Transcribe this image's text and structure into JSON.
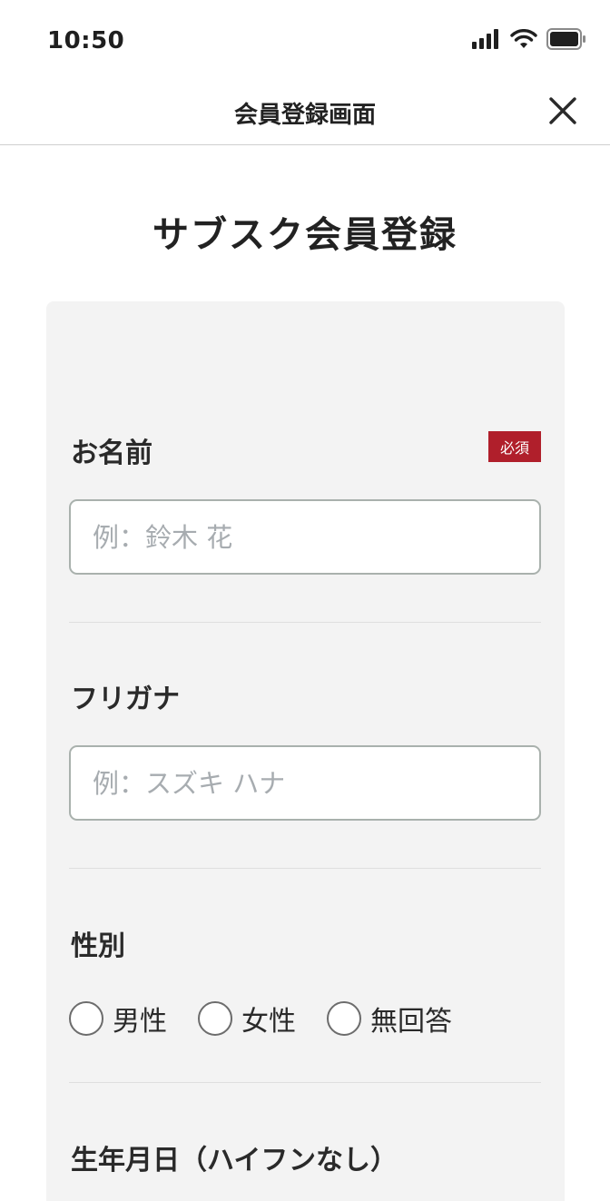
{
  "status_bar": {
    "time": "10:50"
  },
  "nav": {
    "title": "会員登録画面"
  },
  "page": {
    "heading": "サブスク会員登録"
  },
  "form": {
    "name": {
      "label": "お名前",
      "required_badge": "必須",
      "placeholder": "例：鈴木 花"
    },
    "furigana": {
      "label": "フリガナ",
      "placeholder": "例：スズキ ハナ"
    },
    "gender": {
      "label": "性別",
      "options": [
        "男性",
        "女性",
        "無回答"
      ]
    },
    "birthdate": {
      "label": "生年月日（ハイフンなし）"
    }
  },
  "colors": {
    "required_badge": "#b01f2b",
    "card_background": "#f3f3f3",
    "input_border": "#a9b1ad"
  }
}
